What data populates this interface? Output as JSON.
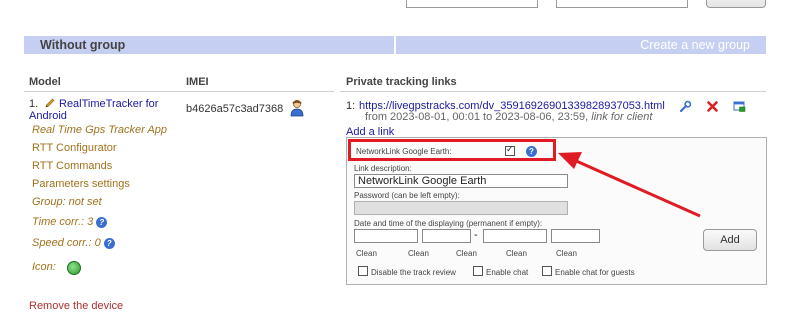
{
  "group": {
    "title": "Without group",
    "create_link": "Create a new group"
  },
  "columns": {
    "model": "Model",
    "imei": "IMEI",
    "links": "Private tracking links"
  },
  "device": {
    "number": "1.",
    "name_line1": "RealTimeTracker for",
    "name_line2": "Android",
    "app": "Real Time Gps Tracker App",
    "configurator": "RTT Configurator",
    "commands": "RTT Commands",
    "params": "Parameters settings",
    "group": "Group: not set",
    "time_corr": "Time corr.: 3",
    "speed_corr": "Speed corr.: 0",
    "icon_label": "Icon:",
    "imei": "b4626a57c3ad7368",
    "remove": "Remove the device"
  },
  "track": {
    "number": "1:",
    "url": "https://livegpstracks.com/dv_35916926901339828937053.html",
    "range": "from 2023-08-01, 00:01 to 2023-08-06, 23:59,",
    "range_suffix": "link for client",
    "add_link": "Add a link"
  },
  "form": {
    "networklink_label": "NetworkLink Google Earth:",
    "networklink_checked": true,
    "description_label": "Link description:",
    "description_value": "NetworkLink Google Earth",
    "password_label": "Password (can be left empty):",
    "datetime_label": "Date and time of the displaying (permanent if empty):",
    "clean": "Clean",
    "dash": "-",
    "add_button": "Add",
    "disable_review": "Disable the track review",
    "enable_chat": "Enable chat",
    "enable_chat_guests": "Enable chat for guests"
  },
  "colors": {
    "group_bar": "#c5cff2",
    "highlight": "#e01b24",
    "link": "#1a1aa0",
    "menu_link": "#a0721c"
  }
}
